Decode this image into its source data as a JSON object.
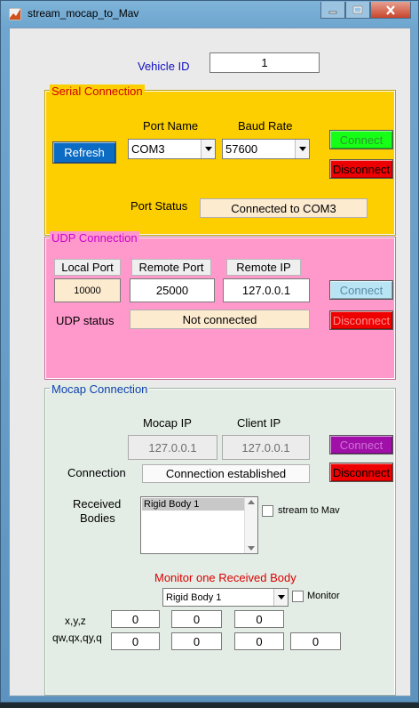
{
  "window": {
    "title": "stream_mocap_to_Mav"
  },
  "vehicle": {
    "label": "Vehicle ID",
    "id_value": "1"
  },
  "serial": {
    "title": "Serial Connection",
    "port_name_label": "Port Name",
    "baud_rate_label": "Baud Rate",
    "refresh_label": "Refresh",
    "port_value": "COM3",
    "baud_value": "57600",
    "connect_label": "Connect",
    "disconnect_label": "Disconnect",
    "port_status_label": "Port Status",
    "port_status_value": "Connected to COM3"
  },
  "udp": {
    "title": "UDP Connection",
    "local_port_label": "Local Port",
    "remote_port_label": "Remote Port",
    "remote_ip_label": "Remote IP",
    "local_port_value": "10000",
    "remote_port_value": "25000",
    "remote_ip_value": "127.0.0.1",
    "connect_label": "Connect",
    "disconnect_label": "Disconnect",
    "status_label": "UDP status",
    "status_value": "Not connected"
  },
  "mocap": {
    "title": "Mocap Connection",
    "mocap_ip_label": "Mocap IP",
    "client_ip_label": "Client IP",
    "mocap_ip_value": "127.0.0.1",
    "client_ip_value": "127.0.0.1",
    "connect_label": "Connect",
    "disconnect_label": "Disconnect",
    "connection_label": "Connection",
    "connection_value": "Connection established",
    "received_label_line1": "Received",
    "received_label_line2": "Bodies",
    "bodies": [
      "Rigid Body 1"
    ],
    "stream_label": "stream to Mav",
    "monitor_title": "Monitor one Received Body",
    "monitor_select_value": "Rigid Body 1",
    "monitor_label": "Monitor",
    "xyz_label": "x,y,z",
    "quat_label": "qw,qx,qy,q",
    "xyz_values": [
      "0",
      "0",
      "0"
    ],
    "quat_values": [
      "0",
      "0",
      "0",
      "0"
    ]
  },
  "colors": {
    "serial_panel": "#fdcf00",
    "udp_panel": "#ff99cc",
    "mocap_panel": "#e3ede5",
    "refresh_button": "#0c6cc4",
    "serial_connect": "#16ff16",
    "disconnect": "#ee0000",
    "udp_connect": "#b8e4f4",
    "mocap_connect": "#a010a8"
  }
}
